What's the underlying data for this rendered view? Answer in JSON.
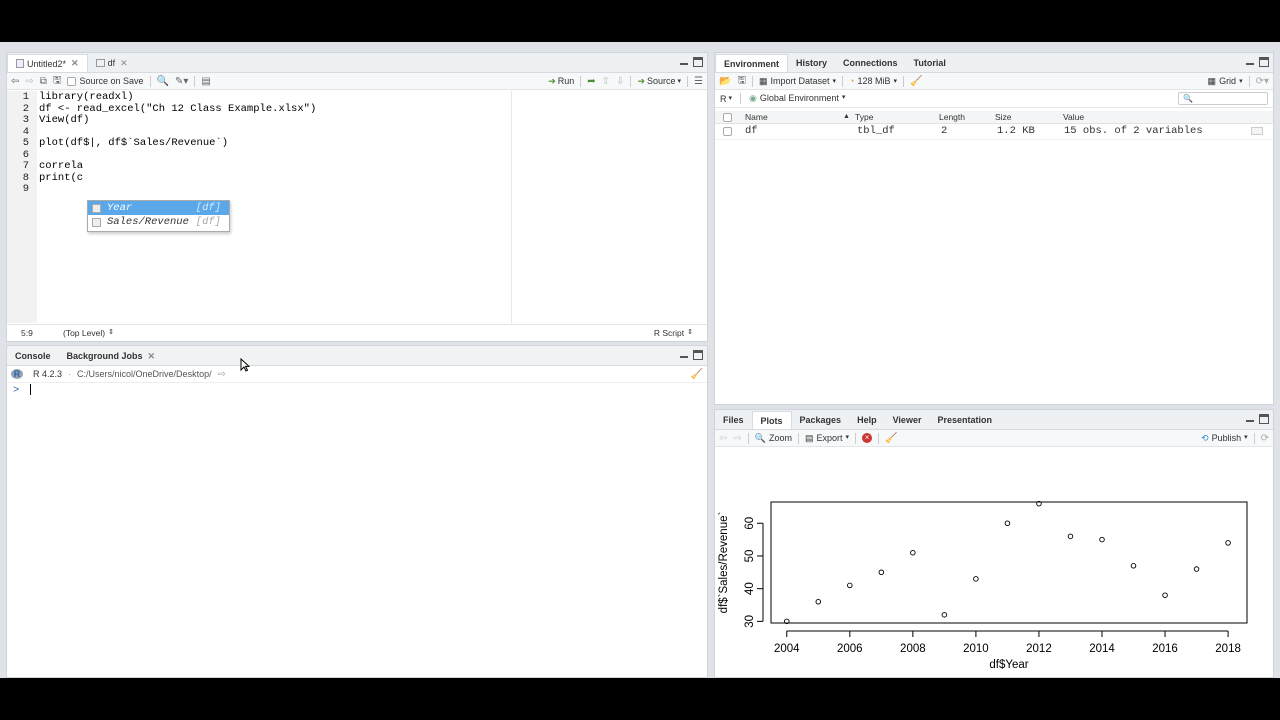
{
  "source_pane": {
    "tabs": [
      {
        "label": "Untitled2*"
      },
      {
        "label": "df"
      }
    ],
    "toolbar": {
      "source_on_save": "Source on Save",
      "run": "Run",
      "source": "Source"
    },
    "lines": [
      {
        "num": "1",
        "text": "library(readxl)"
      },
      {
        "num": "2",
        "text": "df <- read_excel(\"Ch 12 Class Example.xlsx\")"
      },
      {
        "num": "3",
        "text": "View(df)"
      },
      {
        "num": "4",
        "text": ""
      },
      {
        "num": "5",
        "text": "plot(df$|, df$`Sales/Revenue`)"
      },
      {
        "num": "6",
        "text": ""
      },
      {
        "num": "7",
        "text": "correla"
      },
      {
        "num": "8",
        "text": "print(c"
      },
      {
        "num": "9",
        "text": ""
      }
    ],
    "autocomplete": [
      {
        "name": "Year",
        "src": "[df]"
      },
      {
        "name": "Sales/Revenue",
        "src": "[df]"
      }
    ],
    "status": {
      "position": "5:9",
      "scope": "(Top Level)",
      "filetype": "R Script"
    }
  },
  "console_pane": {
    "tabs": [
      {
        "label": "Console"
      },
      {
        "label": "Background Jobs"
      }
    ],
    "r_version": "R 4.2.3",
    "path": "C:/Users/nicol/OneDrive/Desktop/",
    "prompt": ">"
  },
  "env_pane": {
    "tabs": [
      {
        "label": "Environment"
      },
      {
        "label": "History"
      },
      {
        "label": "Connections"
      },
      {
        "label": "Tutorial"
      }
    ],
    "toolbar": {
      "import": "Import Dataset",
      "memory": "128 MiB",
      "view": "Grid",
      "lang": "R",
      "scope": "Global Environment"
    },
    "columns": {
      "name": "Name",
      "type": "Type",
      "length": "Length",
      "size": "Size",
      "value": "Value"
    },
    "rows": [
      {
        "name": "df",
        "type": "tbl_df",
        "length": "2",
        "size": "1.2 KB",
        "value": "15 obs. of 2 variables"
      }
    ]
  },
  "files_pane": {
    "tabs": [
      {
        "label": "Files"
      },
      {
        "label": "Plots"
      },
      {
        "label": "Packages"
      },
      {
        "label": "Help"
      },
      {
        "label": "Viewer"
      },
      {
        "label": "Presentation"
      }
    ],
    "toolbar": {
      "zoom": "Zoom",
      "export": "Export",
      "publish": "Publish"
    }
  },
  "chart_data": {
    "type": "scatter",
    "title": "",
    "xlabel": "df$Year",
    "ylabel": "df$`Sales/Revenue`",
    "xlim": [
      2003.5,
      2018.6
    ],
    "ylim": [
      29.5,
      66.5
    ],
    "xticks": [
      2004,
      2006,
      2008,
      2010,
      2012,
      2014,
      2016,
      2018
    ],
    "yticks": [
      30,
      40,
      50,
      60
    ],
    "grid": false,
    "x": [
      2004,
      2005,
      2006,
      2007,
      2008,
      2009,
      2010,
      2011,
      2012,
      2013,
      2014,
      2015,
      2016,
      2017,
      2018
    ],
    "y": [
      30,
      36,
      41,
      45,
      51,
      32,
      43,
      60,
      66,
      56,
      55,
      47,
      38,
      46,
      54
    ]
  }
}
